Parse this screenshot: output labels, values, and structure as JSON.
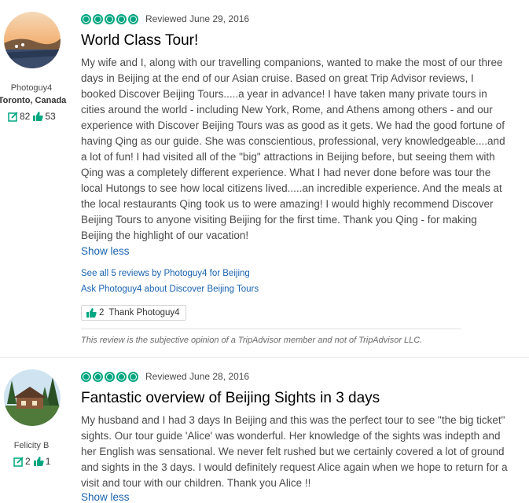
{
  "reviews": [
    {
      "member": {
        "name": "Photoguy4",
        "location": "Toronto, Canada",
        "review_count": "82",
        "helpful_votes": "53"
      },
      "rating": 5,
      "reviewed_date": "Reviewed June 29, 2016",
      "title": "World Class Tour!",
      "lines": [
        "My wife and I, along with our travelling companions, wanted to make the most of our three",
        "days in Beijing at the end of our Asian cruise. Based on great Trip Advisor reviews, I",
        "booked Discover Beijing Tours.....a year in advance! I have taken many private tours in",
        "cities around the world - including New York, Rome, and Athens among others - and our",
        "experience with Discover Beijing Tours was as good as it gets. We had the good fortune of",
        "having Qing as our guide. She was conscientious, professional, very knowledgeable....and",
        "a lot of fun! I had visited all of the \"big\" attractions in Beijing before, but seeing them with",
        "Qing was a completely different experience. What I had never done before was tour the",
        "local Hutongs to see how local citizens lived.....an incredible experience. And the meals at",
        "the local restaurants Qing took us to were amazing! I would highly recommend Discover",
        "Beijing Tours to anyone visiting Beijing for the first time. Thank you Qing - for making",
        "Beijing the highlight of our vacation!"
      ],
      "show_less": "Show less",
      "see_all_link": "See all 5 reviews by Photoguy4 for Beijing",
      "ask_link": "Ask Photoguy4 about Discover Beijing Tours",
      "thank_count": "2",
      "thank_label": "Thank Photoguy4",
      "disclaimer": "This review is the subjective opinion of a TripAdvisor member and not of TripAdvisor LLC."
    },
    {
      "member": {
        "name": "Felicity B",
        "review_count": "2",
        "helpful_votes": "1"
      },
      "rating": 5,
      "reviewed_date": "Reviewed June 28, 2016",
      "title": "Fantastic overview of Beijing Sights in 3 days",
      "lines": [
        "My husband and I had 3 days In Beijing and this was the perfect tour to see \"the big ticket\"",
        "sights. Our tour guide 'Alice' was wonderful. Her knowledge of the sights was indepth and",
        "her English was sensational. We never felt rushed but we certainly covered a lot of ground",
        "and sights in the 3 days. I would definitely request Alice again when we hope to return for a",
        "visit and tour with our children. Thank you Alice !!"
      ],
      "show_less": "Show less"
    }
  ],
  "colors": {
    "accent": "#00a680",
    "link": "#1a63b0",
    "title": "#000000"
  },
  "icons": {
    "review_count": "review-pencil-icon",
    "helpful": "thumbs-up-icon",
    "rating": "rating-bubble-icon"
  }
}
